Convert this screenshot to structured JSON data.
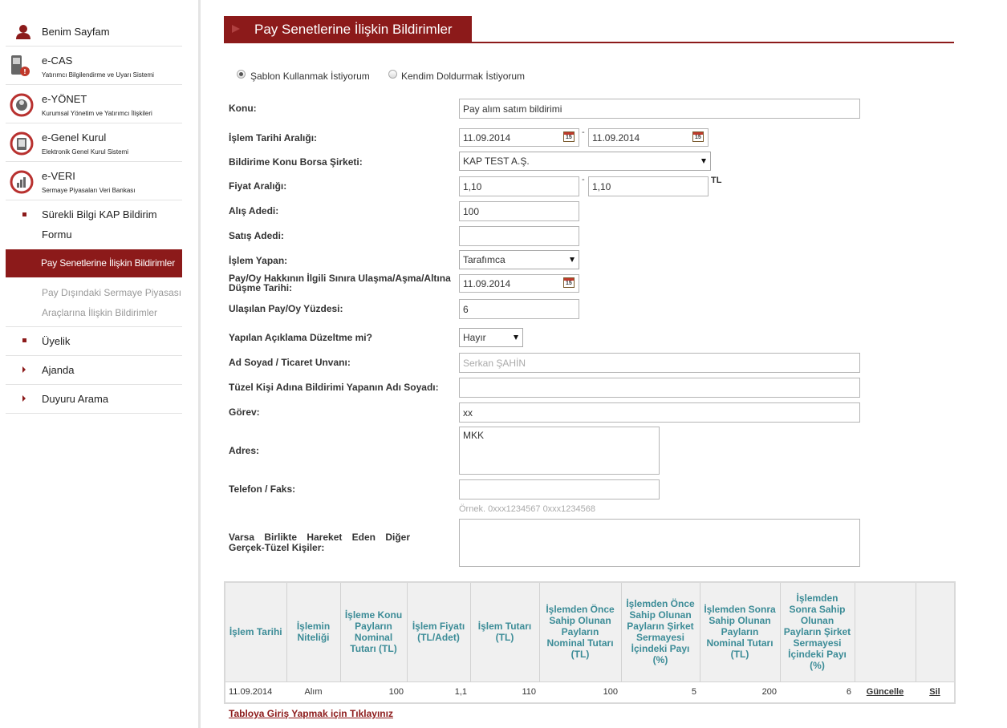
{
  "sidebar": {
    "items": [
      {
        "title": "Benim Sayfam"
      },
      {
        "title": "e-CAS",
        "subtitle": "Yatırımcı Bilgilendirme ve Uyarı Sistemi"
      },
      {
        "title": "e-YÖNET",
        "subtitle": "Kurumsal Yönetim ve Yatırımcı İlişkileri"
      },
      {
        "title": "e-Genel Kurul",
        "subtitle": "Elektronik Genel Kurul Sistemi"
      },
      {
        "title": "e-VERI",
        "subtitle": "Sermaye Piyasaları Veri Bankası"
      }
    ],
    "kap_line1": "Sürekli Bilgi KAP Bildirim",
    "kap_line2": "Formu",
    "active_item": "Pay Senetlerine İlişkin Bildirimler",
    "disabled_line1": "Pay Dışındaki Sermaye Piyasası",
    "disabled_line2": "Araçlarına İlişkin Bildirimler",
    "uyelik": "Üyelik",
    "ajanda": "Ajanda",
    "duyuru": "Duyuru Arama"
  },
  "page": {
    "title": "Pay Senetlerine İlişkin Bildirimler"
  },
  "radio": {
    "sablon": "Şablon Kullanmak İstiyorum",
    "kendim": "Kendim Doldurmak İstiyorum"
  },
  "form": {
    "konu_label": "Konu:",
    "konu_value": "Pay alım satım bildirimi",
    "islem_tarihi_label": "İşlem Tarihi Aralığı:",
    "islem_tarihi_from": "11.09.2014",
    "islem_tarihi_to": "11.09.2014",
    "borsa_sirketi_label": "Bildirime Konu Borsa Şirketi:",
    "borsa_sirketi_value": "KAP TEST A.Ş.",
    "fiyat_label": "Fiyat Aralığı:",
    "fiyat_from": "1,10",
    "fiyat_to": "1,10",
    "fiyat_unit": "TL",
    "alis_label": "Alış Adedi:",
    "alis_value": "100",
    "satis_label": "Satış Adedi:",
    "satis_value": "",
    "islem_yapan_label": "İşlem Yapan:",
    "islem_yapan_value": "Tarafımca",
    "sinir_label_1": "Pay/Oy Hakkının İlgili Sınıra Ulaşma/Aşma/Altına",
    "sinir_label_2": "Düşme Tarihi:",
    "sinir_value": "11.09.2014",
    "yuzde_label": "Ulaşılan Pay/Oy Yüzdesi:",
    "yuzde_value": "6",
    "duzeltme_label": "Yapılan Açıklama Düzeltme mi?",
    "duzeltme_value": "Hayır",
    "ad_label": "Ad Soyad / Ticaret Unvanı:",
    "ad_value": "Serkan ŞAHİN",
    "tuzel_label": "Tüzel Kişi Adına Bildirimi Yapanın Adı Soyadı:",
    "tuzel_value": "",
    "gorev_label": "Görev:",
    "gorev_value": "xx",
    "adres_label": "Adres:",
    "adres_value": "MKK",
    "telefon_label": "Telefon / Faks:",
    "telefon_value": "",
    "telefon_hint": "Örnek. 0xxx1234567 0xxx1234568",
    "varsa_label_1": "Varsa Birlikte Hareket Eden Diğer",
    "varsa_label_2": "Gerçek-Tüzel Kişiler:",
    "varsa_value": ""
  },
  "table": {
    "headers": [
      "İşlem Tarihi",
      "İşlemin Niteliği",
      "İşleme Konu Payların Nominal Tutarı (TL)",
      "İşlem Fiyatı (TL/Adet)",
      "İşlem Tutarı (TL)",
      "İşlemden Önce Sahip Olunan Payların Nominal Tutarı (TL)",
      "İşlemden Önce Sahip Olunan Payların Şirket Sermayesi İçindeki Payı (%)",
      "İşlemden Sonra Sahip Olunan Payların Nominal Tutarı (TL)",
      "İşlemden Sonra Sahip Olunan Payların Şirket Sermayesi İçindeki Payı (%)",
      "",
      ""
    ],
    "row": {
      "tarih": "11.09.2014",
      "nitelik": "Alım",
      "nominal": "100",
      "fiyat": "1,1",
      "tutar": "110",
      "once_nominal": "100",
      "once_pay": "5",
      "sonra_nominal": "200",
      "sonra_pay": "6",
      "guncelle": "Güncelle",
      "sil": "Sil"
    },
    "link": "Tabloya Giriş Yapmak için Tıklayınız"
  }
}
